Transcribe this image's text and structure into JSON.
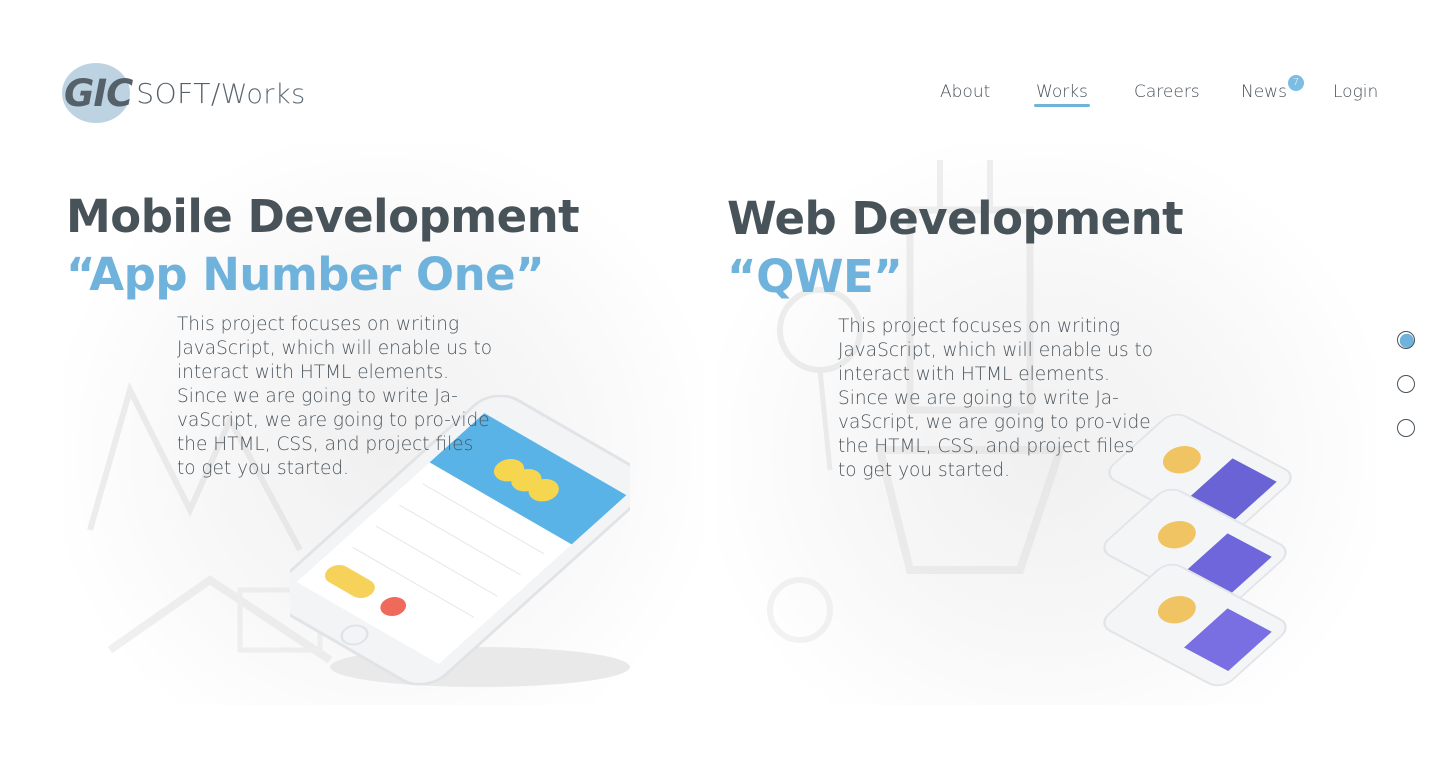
{
  "logo": {
    "gic": "GIC",
    "soft": "SOFT/",
    "works": "Works"
  },
  "nav": {
    "items": [
      {
        "label": "About"
      },
      {
        "label": "Works",
        "active": true
      },
      {
        "label": "Careers"
      },
      {
        "label": "News",
        "badge": "7"
      },
      {
        "label": "Login"
      }
    ]
  },
  "sections": [
    {
      "title": "Mobile Development",
      "subtitle": "“App Number One”",
      "description": "This project focuses on writing JavaScript, which will enable us to interact with HTML elements. Since we are going to write Ja-vaScript, we are going to pro-vide the HTML, CSS, and project files to get you started."
    },
    {
      "title": "Web Development",
      "subtitle": "“QWE”",
      "description": "This project focuses on writing JavaScript, which will enable us to interact with HTML elements. Since we are going to write Ja-vaScript, we are going to pro-vide the HTML, CSS, and project files to get you started."
    }
  ],
  "pager": {
    "count": 3,
    "active_index": 0
  },
  "colors": {
    "accent": "#6fb3dc",
    "heading": "#475259",
    "text": "#4d575f"
  }
}
